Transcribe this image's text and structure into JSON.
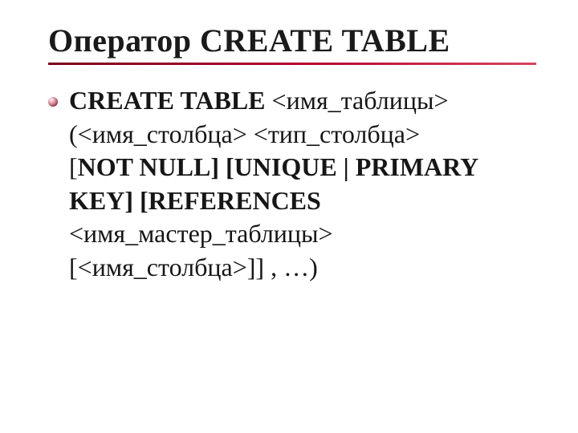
{
  "title": "Оператор CREATE TABLE",
  "body": {
    "l1_bold": "CREATE TABLE ",
    "l1_normal": "<имя_таблицы>",
    "l2_normal": "(<имя_столбца> <тип_столбца>",
    "l3": "[",
    "l3_bold": "NOT NULL] [UNIQUE | PRIMARY KEY] [REFERENCES ",
    "l3_normal2": "<имя_мастер_таблицы> [<имя_столбца>]] , …)"
  }
}
